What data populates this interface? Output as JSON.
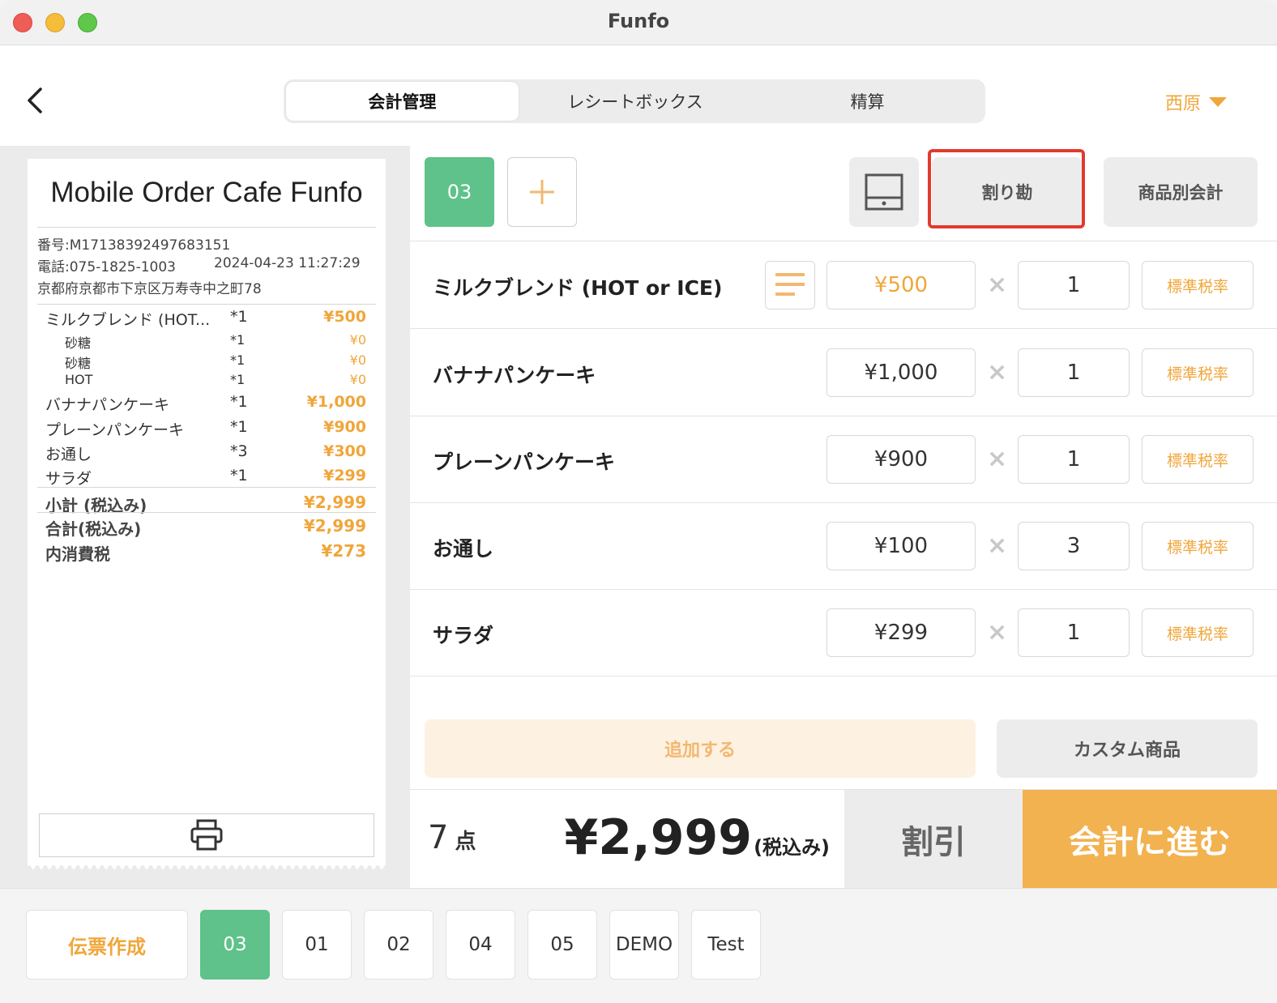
{
  "window": {
    "title": "Funfo"
  },
  "header": {
    "tabs": [
      {
        "label": "会計管理",
        "active": true
      },
      {
        "label": "レシートボックス",
        "active": false
      },
      {
        "label": "精算",
        "active": false
      }
    ],
    "user": "西原"
  },
  "receipt": {
    "shop_name": "Mobile Order Cafe Funfo",
    "number": "番号:M17138392497683151",
    "phone": "電話:075-1825-1003",
    "datetime": "2024-04-23 11:27:29",
    "address": "京都府京都市下京区万寿寺中之町78",
    "items": [
      {
        "name": "ミルクブレンド (HOT...",
        "qty": "*1",
        "price": "¥500"
      },
      {
        "name": "砂糖",
        "qty": "*1",
        "price": "¥0",
        "sub": true
      },
      {
        "name": "砂糖",
        "qty": "*1",
        "price": "¥0",
        "sub": true
      },
      {
        "name": "HOT",
        "qty": "*1",
        "price": "¥0",
        "sub": true
      },
      {
        "name": "バナナパンケーキ",
        "qty": "*1",
        "price": "¥1,000"
      },
      {
        "name": "プレーンパンケーキ",
        "qty": "*1",
        "price": "¥900"
      },
      {
        "name": "お通し",
        "qty": "*3",
        "price": "¥300"
      },
      {
        "name": "サラダ",
        "qty": "*1",
        "price": "¥299"
      }
    ],
    "subtotal_label": "小計 (税込み)",
    "subtotal": "¥2,999",
    "total_label": "合計(税込み)",
    "total": "¥2,999",
    "tax_label": "内消費税",
    "tax": "¥273",
    "print_icon": "printer-icon"
  },
  "toolbar": {
    "active_tab": "03",
    "add_icon": "plus-icon",
    "drawer_icon": "cash-drawer-icon",
    "split_label": "割り勘",
    "by_item_label": "商品別会計",
    "highlight_color": "#e23a2e"
  },
  "order_lines": [
    {
      "name": "ミルクブレンド (HOT or ICE)",
      "price": "¥500",
      "qty": "1",
      "tax": "標準税率",
      "has_memo": true,
      "price_highlight": true
    },
    {
      "name": "バナナパンケーキ",
      "price": "¥1,000",
      "qty": "1",
      "tax": "標準税率",
      "has_memo": false
    },
    {
      "name": "プレーンパンケーキ",
      "price": "¥900",
      "qty": "1",
      "tax": "標準税率",
      "has_memo": false
    },
    {
      "name": "お通し",
      "price": "¥100",
      "qty": "3",
      "tax": "標準税率",
      "has_memo": false
    },
    {
      "name": "サラダ",
      "price": "¥299",
      "qty": "1",
      "tax": "標準税率",
      "has_memo": false
    }
  ],
  "multiply_symbol": "×",
  "actions": {
    "add_label": "追加する",
    "custom_label": "カスタム商品"
  },
  "summary": {
    "count": "7",
    "count_unit": "点",
    "total": "¥2,999",
    "total_suffix": "(税込み)",
    "discount_label": "割引",
    "checkout_label": "会計に進む"
  },
  "footer": {
    "new_slip_label": "伝票作成",
    "tabs": [
      {
        "label": "03",
        "active": true
      },
      {
        "label": "01"
      },
      {
        "label": "02"
      },
      {
        "label": "04"
      },
      {
        "label": "05"
      },
      {
        "label": "DEMO"
      },
      {
        "label": "Test"
      }
    ]
  },
  "colors": {
    "accent": "#f0a63a",
    "green": "#5ec28a",
    "checkout": "#f2b24f"
  }
}
